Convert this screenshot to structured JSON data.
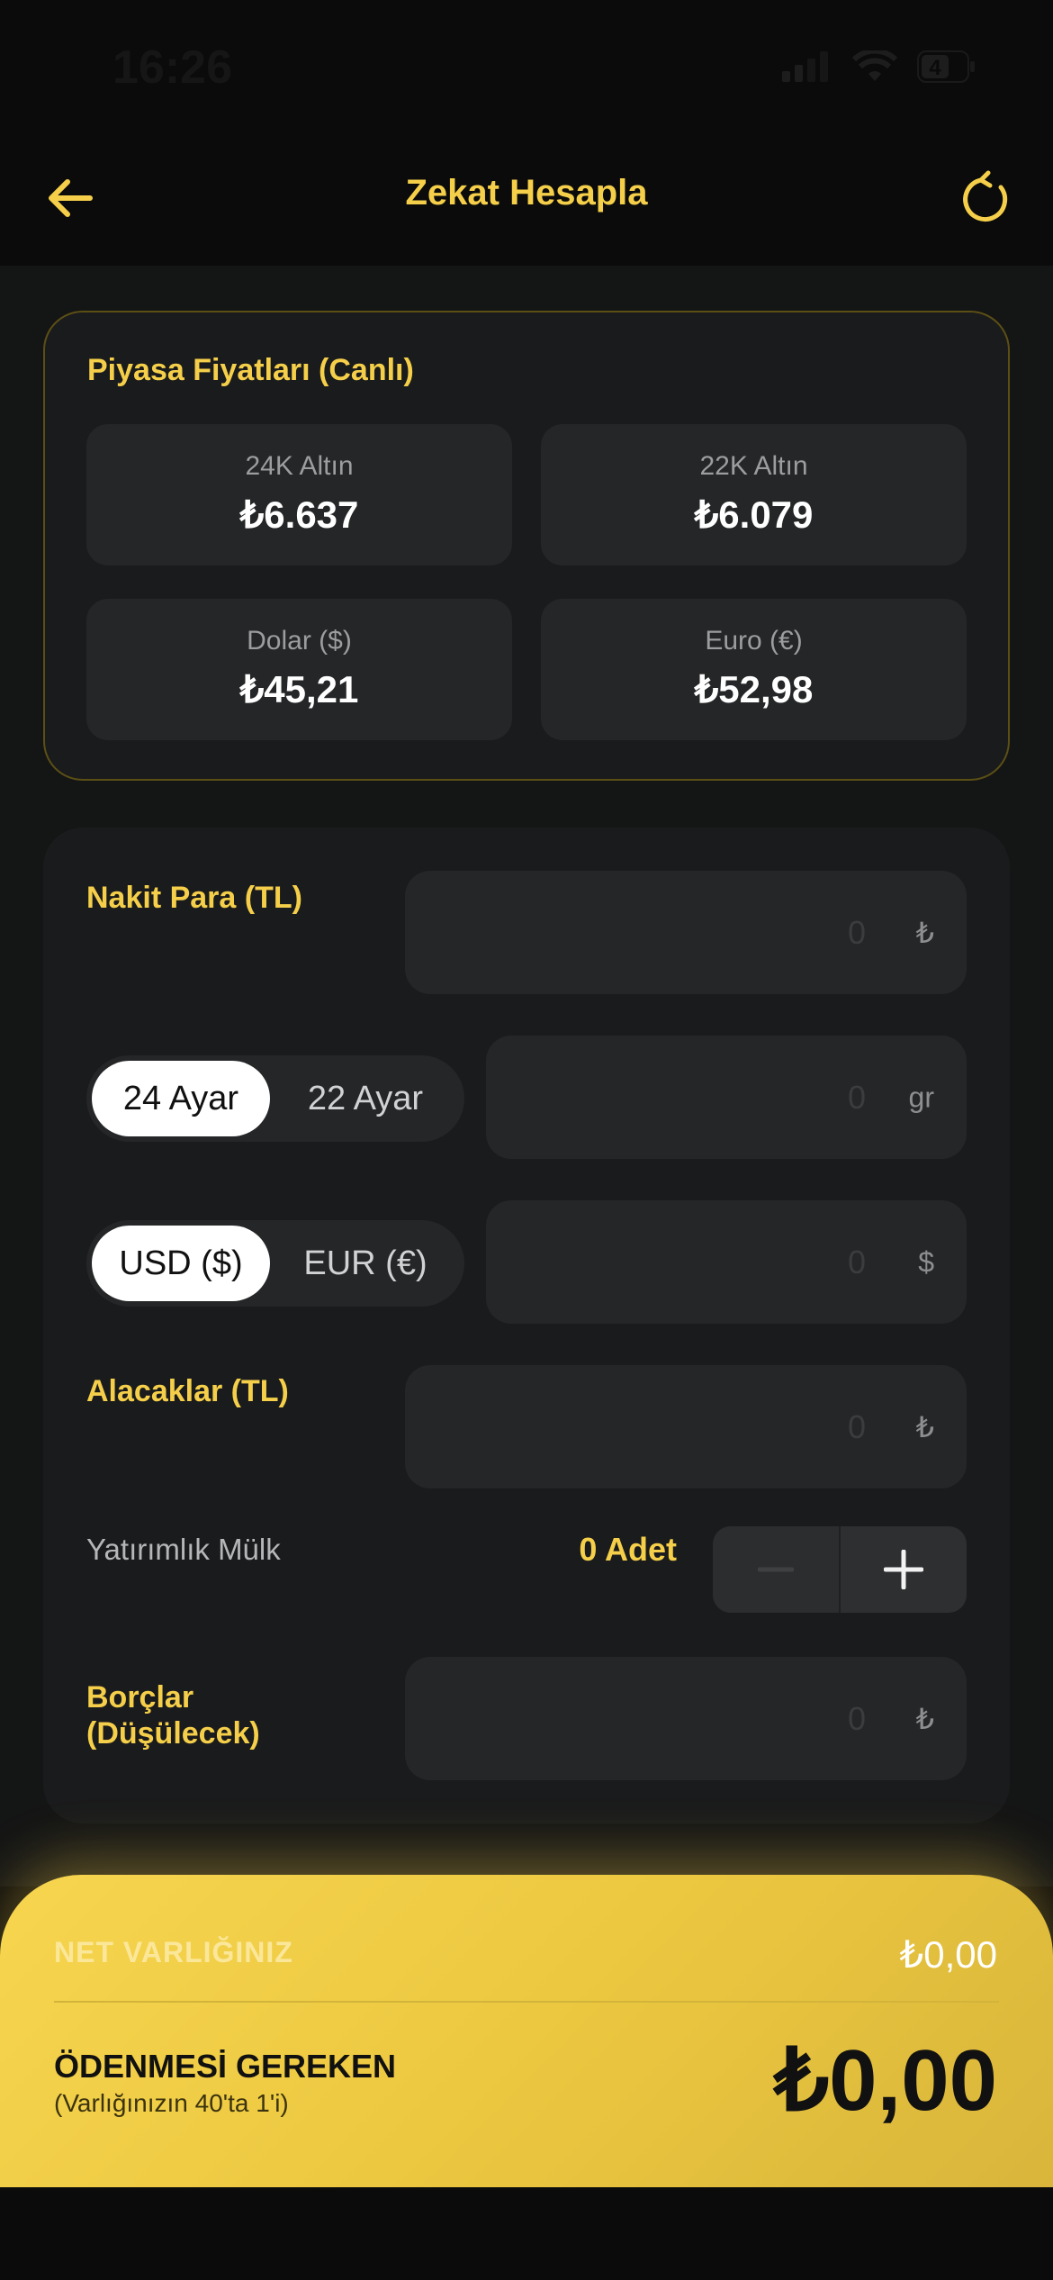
{
  "status_bar": {
    "time": "16:26",
    "battery": "4"
  },
  "header": {
    "title": "Zekat Hesapla"
  },
  "prices": {
    "title": "Piyasa Fiyatları (Canlı)",
    "items": [
      {
        "label": "24K Altın",
        "value": "₺6.637"
      },
      {
        "label": "22K Altın",
        "value": "₺6.079"
      },
      {
        "label": "Dolar ($)",
        "value": "₺45,21"
      },
      {
        "label": "Euro (€)",
        "value": "₺52,98"
      }
    ]
  },
  "form": {
    "cash": {
      "label": "Nakit Para (TL)",
      "value": "0",
      "unit": "₺"
    },
    "gold": {
      "options": [
        "24 Ayar",
        "22 Ayar"
      ],
      "selected": "24 Ayar",
      "value": "0",
      "unit": "gr"
    },
    "currency": {
      "options": [
        "USD ($)",
        "EUR (€)"
      ],
      "selected": "USD ($)",
      "value": "0",
      "unit": "$"
    },
    "receivables": {
      "label": "Alacaklar (TL)",
      "value": "0",
      "unit": "₺"
    },
    "property": {
      "label": "Yatırımlık Mülk",
      "count_text": "0 Adet"
    },
    "debts": {
      "label_line1": "Borçlar",
      "label_line2": "(Düşülecek)",
      "value": "0",
      "unit": "₺"
    }
  },
  "summary": {
    "net_label": "NET VARLIĞINIZ",
    "net_value": "₺0,00",
    "due_label": "ÖDENMESİ GEREKEN",
    "due_sub": "(Varlığınızın 40'ta 1'i)",
    "due_value": "₺0,00"
  },
  "colors": {
    "accent": "#f5cf4a",
    "background": "#0b0b0b",
    "card": "#1a1b1c",
    "tile": "#242627"
  },
  "icons": [
    "back-arrow-icon",
    "refresh-icon",
    "minus-icon",
    "plus-icon",
    "signal-icon",
    "wifi-icon",
    "battery-icon"
  ]
}
